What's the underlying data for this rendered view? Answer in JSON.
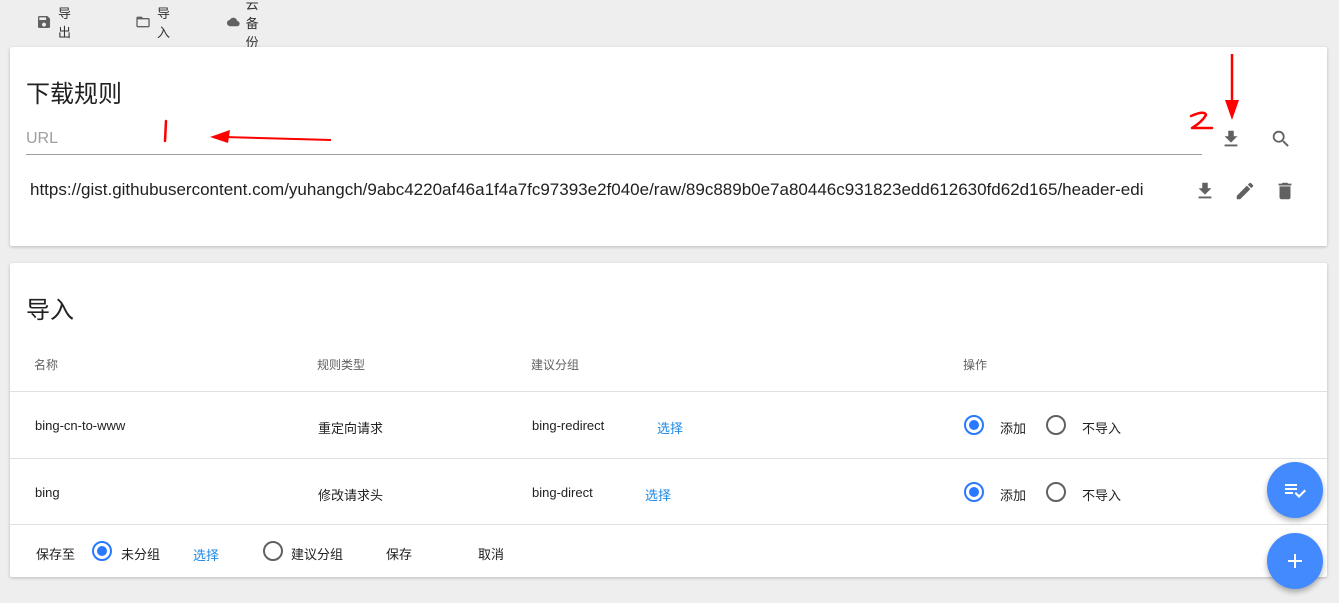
{
  "toolbar": {
    "export_label": "导出",
    "import_label": "导入",
    "cloud_backup_label": "云备份"
  },
  "download_rules": {
    "title": "下载规则",
    "url_placeholder": "URL",
    "url_value": "",
    "rules": [
      {
        "url": "https://gist.githubusercontent.com/yuhangch/9abc4220af46a1f4a7fc97393e2f040e/raw/89c889b0e7a80446c931823edd612630fd62d165/header-edi"
      }
    ]
  },
  "annotations": {
    "marker_1": "1",
    "marker_2": "2",
    "color": "#ff0000"
  },
  "import": {
    "title": "导入",
    "headers": {
      "name": "名称",
      "rule_type": "规则类型",
      "suggested_group": "建议分组",
      "action": "操作"
    },
    "rows": [
      {
        "name": "bing-cn-to-www",
        "rule_type": "重定向请求",
        "group": "bing-redirect",
        "choose": "选择",
        "add_label": "添加",
        "skip_label": "不导入",
        "selected": "add"
      },
      {
        "name": "bing",
        "rule_type": "修改请求头",
        "group": "bing-direct",
        "choose": "选择",
        "add_label": "添加",
        "skip_label": "不导入",
        "selected": "add"
      }
    ],
    "footer": {
      "save_to_label": "保存至",
      "ungrouped_label": "未分组",
      "choose_label": "选择",
      "suggested_group_label": "建议分组",
      "save_label": "保存",
      "cancel_label": "取消",
      "selected": "ungrouped"
    }
  },
  "colors": {
    "accent": "#2979ff",
    "link": "#1e88e5",
    "fab": "#448aff",
    "background": "#eeeeee"
  },
  "icons": {
    "export": "save-icon",
    "import": "folder-icon",
    "cloud": "cloud-icon",
    "download": "download-icon",
    "search": "search-icon",
    "edit": "pencil-icon",
    "delete": "trash-icon",
    "fab_top": "playlist-check-icon",
    "fab_bottom": "plus-icon"
  }
}
